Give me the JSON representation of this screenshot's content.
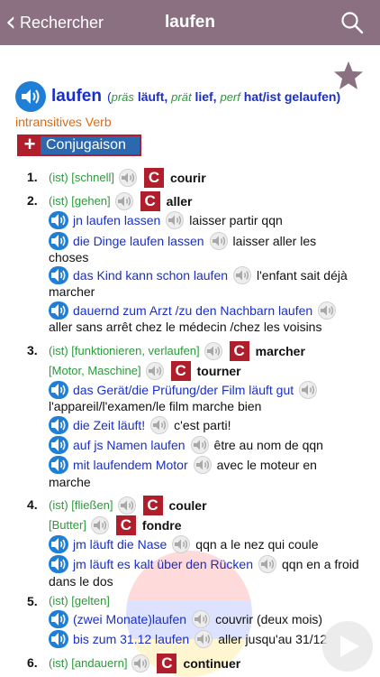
{
  "nav": {
    "back_label": "Rechercher",
    "title": "laufen"
  },
  "entry": {
    "lemma": "laufen",
    "open_paren": "(",
    "pres_label": "präs",
    "pres_form": "läuft,",
    "pret_label": "prät",
    "pret_form": "lief,",
    "perf_label": "perf",
    "perf_form": "hat/ist gelaufen)",
    "word_class": "intransitives Verb",
    "conj_label": "Conjugaison",
    "conj_plus": "+"
  },
  "senses": [
    {
      "num": "1.",
      "meta": "(ist) [schnell]",
      "trans": "courir"
    },
    {
      "num": "2.",
      "meta": "(ist) [gehen]",
      "trans": "aller"
    },
    {
      "num": "3.",
      "meta": "(ist) [funktionieren, verlaufen]",
      "trans": "marcher",
      "meta2": "[Motor, Maschine]",
      "trans2": "tourner"
    },
    {
      "num": "4.",
      "meta": "(ist) [fließen]",
      "trans": "couler",
      "meta2": "[Butter]",
      "trans2": "fondre"
    },
    {
      "num": "5.",
      "meta": "(ist) [gelten]"
    },
    {
      "num": "6.",
      "meta": "(ist) [andauern]",
      "trans": "continuer"
    }
  ],
  "examples": [
    {
      "de": "jn laufen lassen",
      "fr": "laisser partir qqn"
    },
    {
      "de": "die Dinge laufen lassen",
      "fr": "laisser aller les",
      "cont": "choses"
    },
    {
      "de": "das Kind kann schon laufen",
      "fr": "l'enfant sait déjà",
      "cont": "marcher"
    },
    {
      "de": "dauernd zum Arzt /zu den Nachbarn laufen",
      "fr": "",
      "cont": "aller sans arrêt chez le médecin /chez les voisins"
    },
    {
      "de": "das Gerät/die Prüfung/der Film läuft gut",
      "fr": "",
      "cont": "l'appareil/l'examen/le film marche bien"
    },
    {
      "de": "die Zeit läuft!",
      "fr": "c'est parti!"
    },
    {
      "de": "auf js Namen laufen",
      "fr": "être au nom de qqn"
    },
    {
      "de": "mit laufendem Motor",
      "fr": "avec le moteur en",
      "cont": "marche"
    },
    {
      "de": "jm läuft die Nase",
      "fr": "qqn a le nez qui coule"
    },
    {
      "de": "jm läuft es kalt über den Rücken",
      "fr": "qqn en a froid",
      "cont": "dans le dos"
    },
    {
      "de": "(zwei Monate)laufen",
      "fr": "couvrir (deux mois)"
    },
    {
      "de": "bis zum 31.12 laufen",
      "fr": "aller jusqu'au 31/12"
    }
  ],
  "c_label": "C"
}
